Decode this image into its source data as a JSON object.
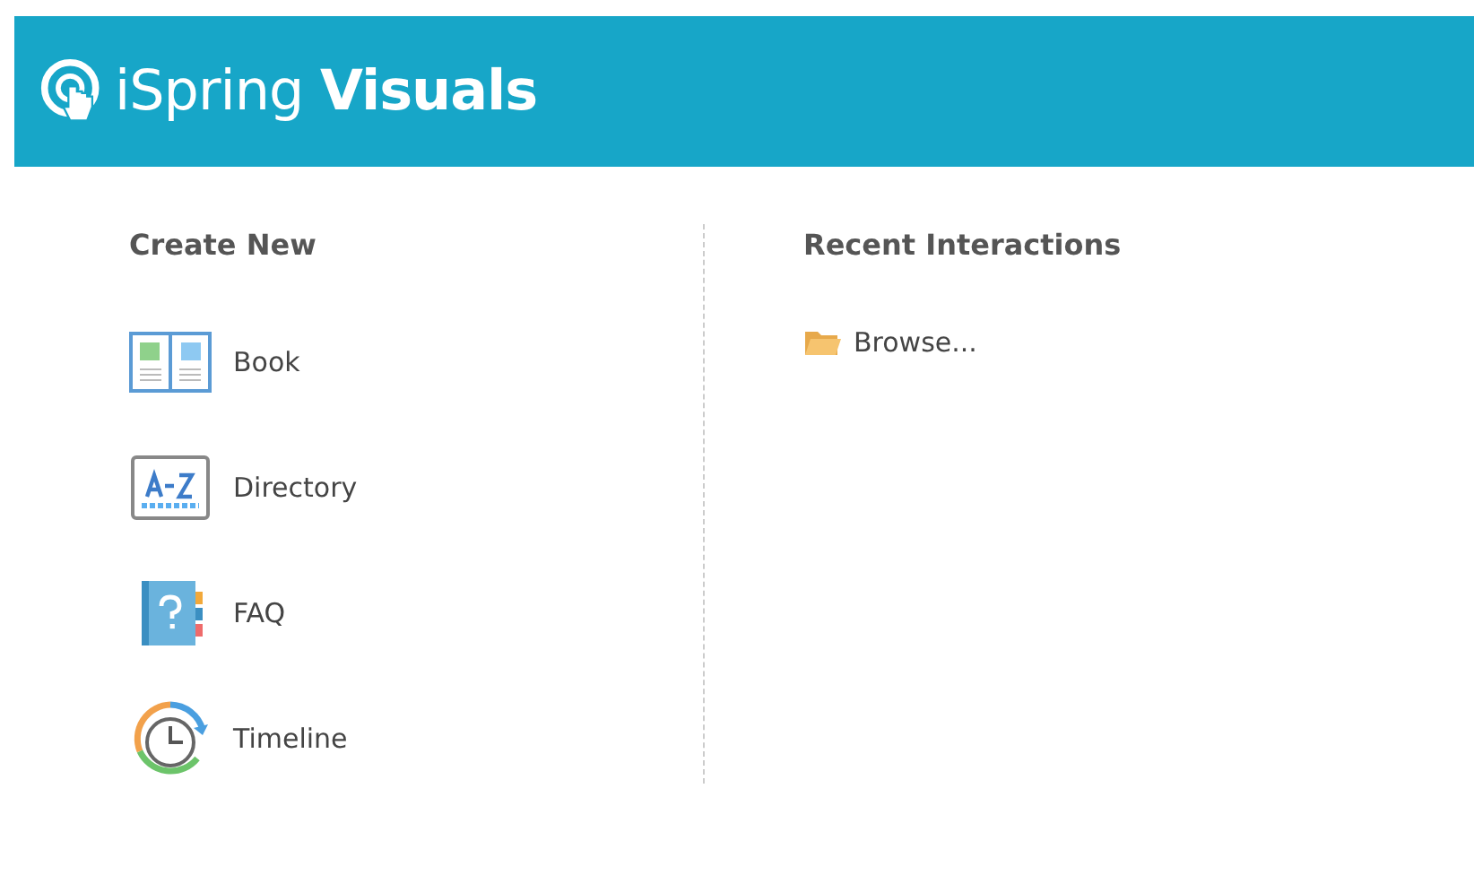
{
  "header": {
    "logo_text": "iSpring **Visuals**"
  },
  "create_new": {
    "title": "Create New",
    "items": [
      {
        "label": "Book",
        "kind": "book"
      },
      {
        "label": "Directory",
        "kind": "directory"
      },
      {
        "label": "FAQ",
        "kind": "faq"
      },
      {
        "label": "Timeline",
        "kind": "timeline"
      }
    ]
  },
  "recent": {
    "title": "Recent Interactions",
    "browse": "Browse..."
  }
}
